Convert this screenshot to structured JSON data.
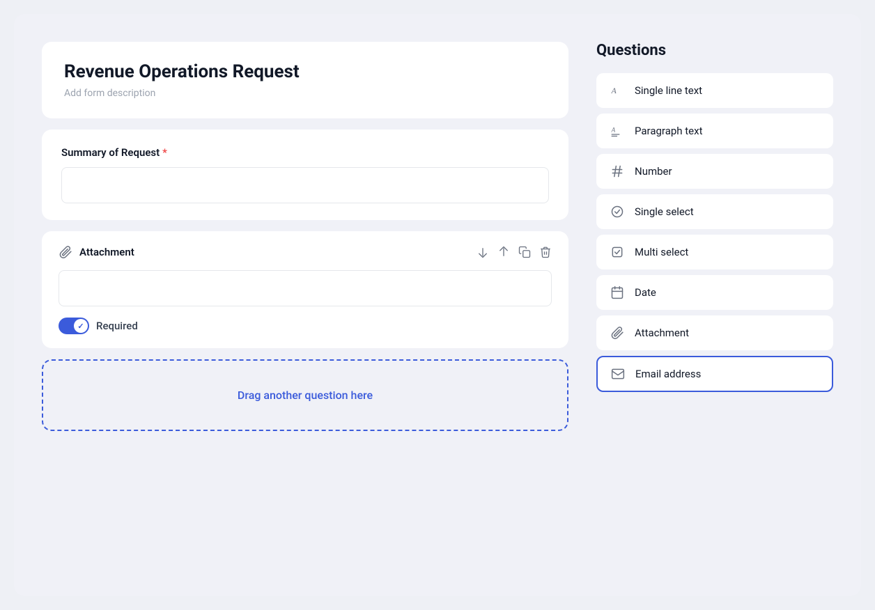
{
  "app": {
    "background_color": "#f0f1f7"
  },
  "form": {
    "title": "Revenue Operations Request",
    "description_placeholder": "Add form description",
    "fields": [
      {
        "id": "summary",
        "label": "Summary of Request",
        "required": true,
        "type": "text"
      },
      {
        "id": "attachment",
        "label": "Attachment",
        "required_toggle": true,
        "required_label": "Required"
      }
    ],
    "drag_zone_text": "Drag another question here"
  },
  "questions_panel": {
    "title": "Questions",
    "items": [
      {
        "id": "single-line-text",
        "label": "Single line text",
        "icon": "single-line-icon"
      },
      {
        "id": "paragraph-text",
        "label": "Paragraph text",
        "icon": "paragraph-icon"
      },
      {
        "id": "number",
        "label": "Number",
        "icon": "number-icon"
      },
      {
        "id": "single-select",
        "label": "Single select",
        "icon": "single-select-icon"
      },
      {
        "id": "multi-select",
        "label": "Multi select",
        "icon": "multi-select-icon"
      },
      {
        "id": "date",
        "label": "Date",
        "icon": "date-icon"
      },
      {
        "id": "attachment",
        "label": "Attachment",
        "icon": "attachment-icon"
      },
      {
        "id": "email-address",
        "label": "Email address",
        "icon": "email-icon",
        "active": true
      }
    ]
  }
}
